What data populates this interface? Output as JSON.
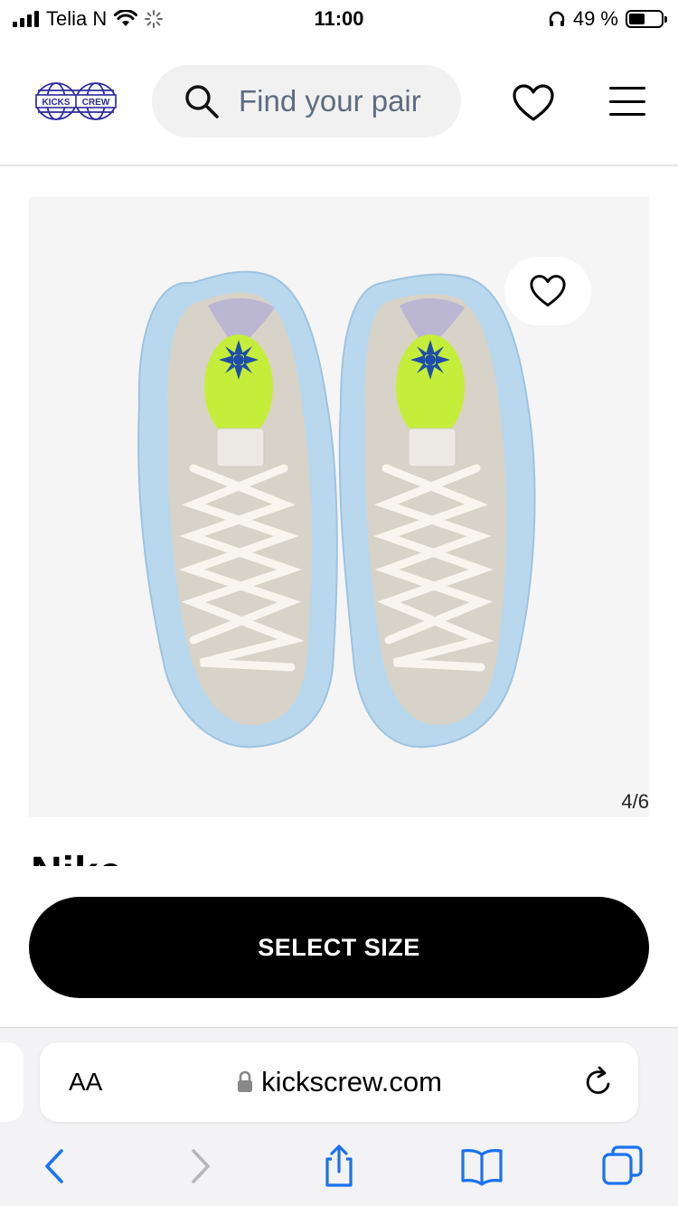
{
  "status_bar": {
    "carrier": "Telia N",
    "time": "11:00",
    "battery_percent": "49 %",
    "battery_level": 0.49
  },
  "header": {
    "logo_text": [
      "KICKS",
      "CREW"
    ],
    "search_placeholder": "Find your pair",
    "icons": [
      "search-icon",
      "heart-icon",
      "menu-icon"
    ]
  },
  "product": {
    "image_counter": "4/6",
    "brand_peek": "Nike",
    "select_size_label": "SELECT SIZE"
  },
  "browser": {
    "text_size_label": "AA",
    "url": "kickscrew.com",
    "icons": [
      "lock-icon",
      "reload-icon",
      "back-icon",
      "forward-icon",
      "share-icon",
      "bookmarks-icon",
      "tabs-icon"
    ]
  },
  "colors": {
    "accent_blue": "#1a72f0",
    "logo_blue": "#2d2a9b",
    "search_bg": "#f1f1f1",
    "button_black": "#000000"
  }
}
